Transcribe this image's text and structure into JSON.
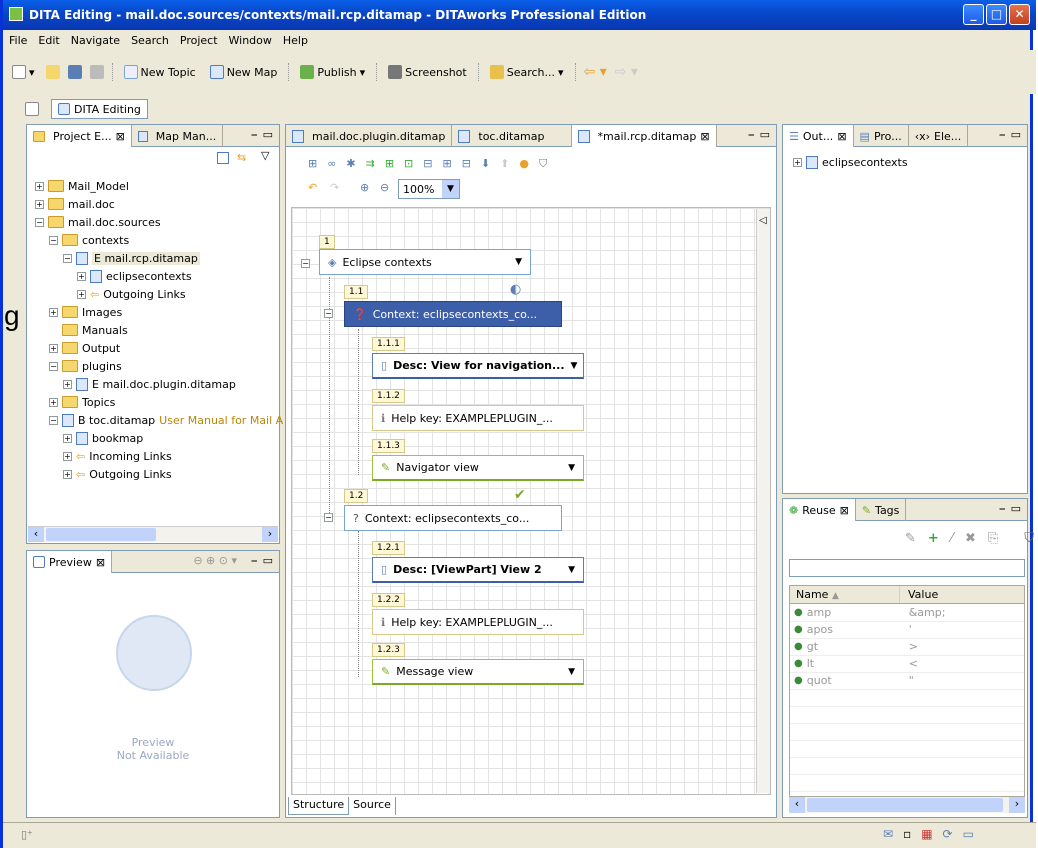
{
  "window": {
    "title": "DITA Editing - mail.doc.sources/contexts/mail.rcp.ditamap - DITAworks Professional Edition"
  },
  "menu": [
    "File",
    "Edit",
    "Navigate",
    "Search",
    "Project",
    "Window",
    "Help"
  ],
  "toolbar": {
    "new_topic": "New Topic",
    "new_map": "New Map",
    "publish": "Publish",
    "screenshot": "Screenshot",
    "search": "Search..."
  },
  "perspective": "DITA Editing",
  "left_tabs": [
    "Project E...",
    "Map Man..."
  ],
  "project_tree": [
    {
      "label": "Mail_Model",
      "indent": 0,
      "pm": "+"
    },
    {
      "label": "mail.doc",
      "indent": 0,
      "pm": "+"
    },
    {
      "label": "mail.doc.sources",
      "indent": 0,
      "pm": "-"
    },
    {
      "label": "contexts",
      "indent": 1,
      "pm": "-"
    },
    {
      "label": "E mail.rcp.ditamap",
      "indent": 2,
      "pm": "-"
    },
    {
      "label": "eclipsecontexts",
      "indent": 3,
      "pm": "+"
    },
    {
      "label": "Outgoing Links",
      "indent": 3,
      "pm": "+"
    },
    {
      "label": "Images",
      "indent": 1,
      "pm": "+"
    },
    {
      "label": "Manuals",
      "indent": 1,
      "pm": ""
    },
    {
      "label": "Output",
      "indent": 1,
      "pm": "+"
    },
    {
      "label": "plugins",
      "indent": 1,
      "pm": "-"
    },
    {
      "label": "E mail.doc.plugin.ditamap",
      "indent": 2,
      "pm": "+"
    },
    {
      "label": "Topics",
      "indent": 1,
      "pm": "+"
    },
    {
      "label": "B toc.ditamap",
      "note": "User Manual for Mail A",
      "indent": 1,
      "pm": "-"
    },
    {
      "label": "bookmap",
      "indent": 2,
      "pm": "+"
    },
    {
      "label": "Incoming Links",
      "indent": 2,
      "pm": "+"
    },
    {
      "label": "Outgoing Links",
      "indent": 2,
      "pm": "+"
    }
  ],
  "preview": {
    "tab": "Preview",
    "text1": "Preview",
    "text2": "Not Available"
  },
  "editor_tabs": [
    "mail.doc.plugin.ditamap",
    "toc.ditamap",
    "*mail.rcp.ditamap"
  ],
  "zoom": "100%",
  "map_nodes": [
    {
      "num": "1",
      "label": "Eclipse contexts"
    },
    {
      "num": "1.1",
      "label": "Context: eclipsecontexts_co..."
    },
    {
      "num": "1.1.1",
      "label": "Desc: View for navigation..."
    },
    {
      "num": "1.1.2",
      "label": "Help key: EXAMPLEPLUGIN_..."
    },
    {
      "num": "1.1.3",
      "label": "Navigator view"
    },
    {
      "num": "1.2",
      "label": "Context: eclipsecontexts_co..."
    },
    {
      "num": "1.2.1",
      "label": "Desc: [ViewPart] View 2"
    },
    {
      "num": "1.2.2",
      "label": "Help key: EXAMPLEPLUGIN_..."
    },
    {
      "num": "1.2.3",
      "label": "Message view"
    }
  ],
  "editor_bottom_tabs": [
    "Structure",
    "Source"
  ],
  "outline_tabs": [
    "Out...",
    "Pro...",
    "Ele..."
  ],
  "outline_item": "eclipsecontexts",
  "reuse_tabs": [
    "Reuse",
    "Tags"
  ],
  "reuse_table": {
    "headers": [
      "Name",
      "Value"
    ],
    "rows": [
      [
        "amp",
        "&amp;"
      ],
      [
        "apos",
        "'"
      ],
      [
        "gt",
        ">"
      ],
      [
        "lt",
        "<"
      ],
      [
        "quot",
        "\""
      ]
    ]
  },
  "stray_text": "g"
}
